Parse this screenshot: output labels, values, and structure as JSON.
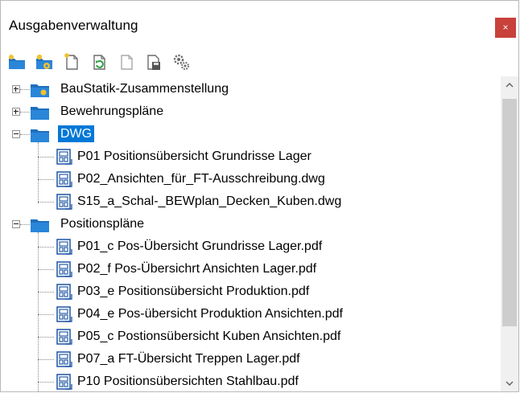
{
  "window": {
    "title": "Ausgabenverwaltung",
    "close_label": "×"
  },
  "toolbar": {
    "buttons": [
      {
        "name": "new-folder-icon"
      },
      {
        "name": "folder-settings-icon"
      },
      {
        "name": "new-document-icon"
      },
      {
        "name": "refresh-document-icon"
      },
      {
        "name": "document-disabled-icon"
      },
      {
        "name": "save-document-icon"
      },
      {
        "name": "gear-settings-icon"
      }
    ]
  },
  "tree": {
    "items": [
      {
        "label": "BauStatik-Zusammenstellung",
        "type": "folder",
        "state": "collapsed",
        "icon": "folder-special-icon"
      },
      {
        "label": "Bewehrungspläne",
        "type": "folder",
        "state": "collapsed",
        "icon": "folder-icon"
      },
      {
        "label": "DWG",
        "type": "folder",
        "state": "expanded",
        "selected": true,
        "icon": "folder-icon"
      },
      {
        "label": "P01 Positionsübersicht Grundrisse Lager",
        "type": "file",
        "icon": "layout-file-icon"
      },
      {
        "label": "P02_Ansichten_für_FT-Ausschreibung.dwg",
        "type": "file",
        "icon": "layout-file-icon"
      },
      {
        "label": "S15_a_Schal-_BEWplan_Decken_Kuben.dwg",
        "type": "file",
        "icon": "layout-file-icon"
      },
      {
        "label": "Positionspläne",
        "type": "folder",
        "state": "expanded",
        "icon": "folder-icon"
      },
      {
        "label": "P01_c  Pos-Übersicht Grundrisse Lager.pdf",
        "type": "file",
        "icon": "layout-file-icon"
      },
      {
        "label": "P02_f Pos-Übersichrt Ansichten Lager.pdf",
        "type": "file",
        "icon": "layout-file-icon"
      },
      {
        "label": "P03_e  Positionsübersicht Produktion.pdf",
        "type": "file",
        "icon": "layout-file-icon"
      },
      {
        "label": "P04_e  Pos-übersicht Produktion Ansichten.pdf",
        "type": "file",
        "icon": "layout-file-icon"
      },
      {
        "label": "P05_c Postionsübersicht Kuben Ansichten.pdf",
        "type": "file",
        "icon": "layout-file-icon"
      },
      {
        "label": "P07_a FT-Übersicht Treppen Lager.pdf",
        "type": "file",
        "icon": "layout-file-icon"
      },
      {
        "label": "P10 Positionsübersichten Stahlbau.pdf",
        "type": "file",
        "icon": "layout-file-icon"
      }
    ]
  },
  "colors": {
    "selection": "#0078d7",
    "folder": "#1e6fbf",
    "close_button": "#c8413b"
  }
}
